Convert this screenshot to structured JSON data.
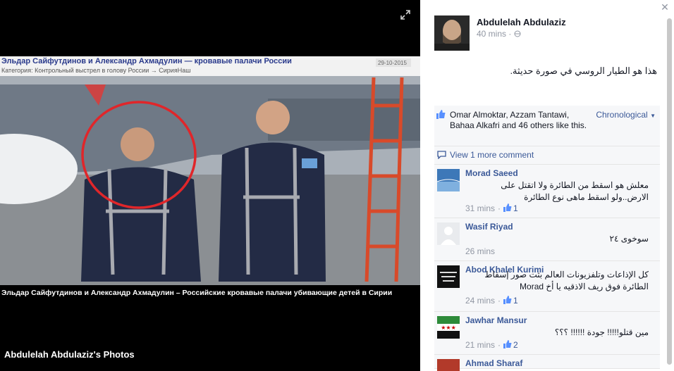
{
  "stage": {
    "photo_caption_top": "Эльдар Сайфутдинов и Александр Ахмадулин — кровавые палачи России",
    "photo_category": "Категория: Контрольный выстрел в голову России → СирияНаш",
    "photo_date": "29-10-2015",
    "photo_caption_bottom": "Эльдар Сайфутдинов и Александр Ахмадулин – Российские кровавые палачи убивающие детей в Сирии",
    "owner_photos": "Abdulelah Abdulaziz's Photos"
  },
  "post": {
    "author": "Abdulelah Abdulaziz",
    "time": "40 mins",
    "text": "هذا هو الطيار الروسي في صورة حديثة."
  },
  "feedback": {
    "likers": "Omar Almoktar, Azzam Tantawi, Bahaa Alkafri and 46 others like this.",
    "order": "Chronological",
    "view_more": "View 1 more comment"
  },
  "comments": [
    {
      "name": "Morad Saeed",
      "text": "معلش هو اسقط من الطائرة ولا اتقتل على الارض..ولو اسقط ماهى نوع الطائرة",
      "time": "31 mins",
      "likes": "1"
    },
    {
      "name": "Wasif Riyad",
      "text": "سوخوى ٢٤",
      "time": "26 mins",
      "likes": ""
    },
    {
      "name": "Abod Khalel Kurimi",
      "text": "كل الإذاعات وتلفزيونات العالم بثت صور إسقاط الطائرة فوق ريف الاذقيه يا أخ Morad",
      "time": "24 mins",
      "likes": "1"
    },
    {
      "name": "Jawhar Mansur",
      "text": "مين قتلو!!!!! جودة !!!!!! ؟؟؟",
      "time": "21 mins",
      "likes": "2"
    },
    {
      "name": "Ahmad Sharaf",
      "text": "",
      "time": "",
      "likes": ""
    }
  ],
  "colors": {
    "link": "#3b5998",
    "meta": "#9197a3",
    "accent_red": "#e0262a"
  }
}
